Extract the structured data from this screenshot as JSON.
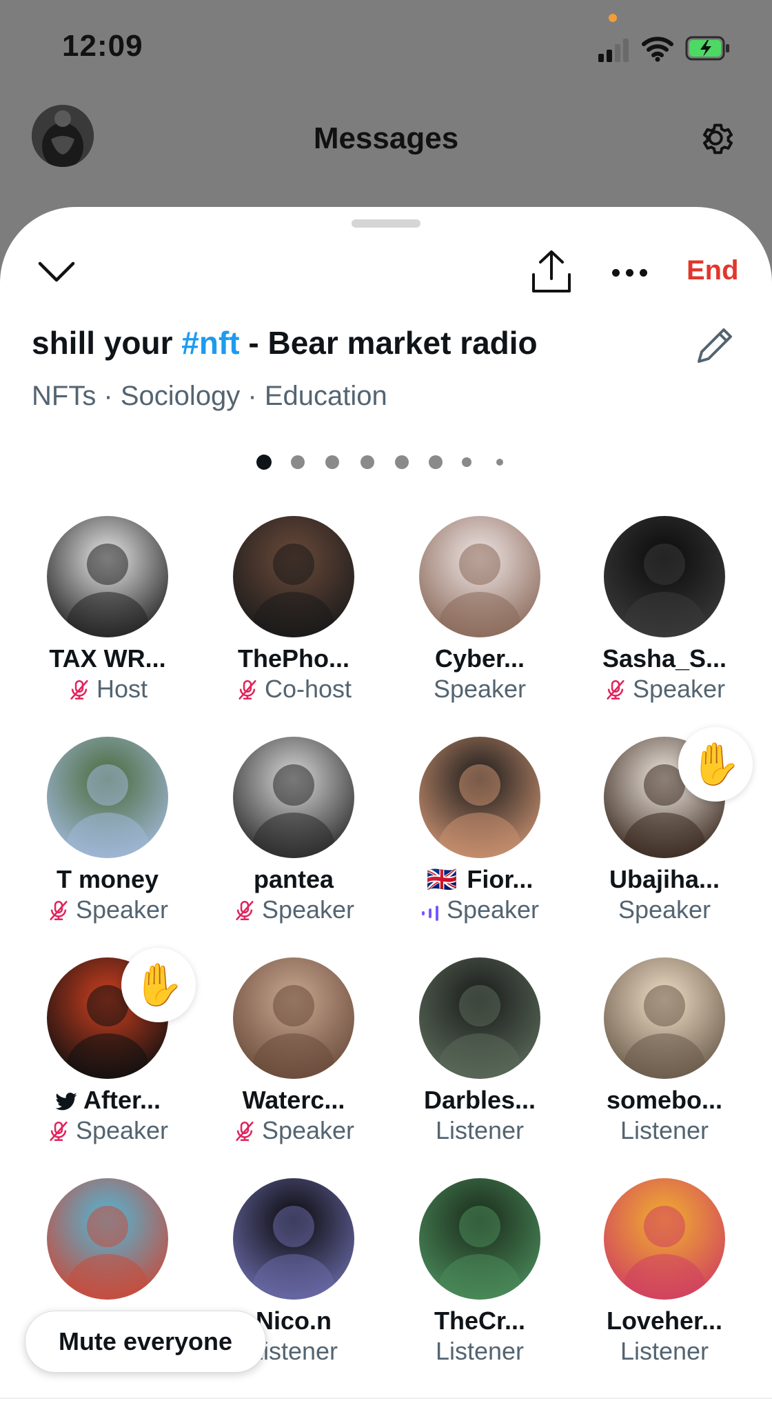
{
  "status_bar": {
    "time": "12:09"
  },
  "header": {
    "title": "Messages",
    "avatar_icon": "profile-avatar",
    "settings_icon": "gear-icon"
  },
  "space": {
    "title_prefix": "shill your ",
    "title_tag": "#nft",
    "title_suffix": " - Bear market radio",
    "topics": "NFTs · Sociology · Education",
    "end_label": "End",
    "page_index": 1,
    "page_count": 8
  },
  "participants": [
    {
      "name": "TAX WR...",
      "role": "Host",
      "muted": true,
      "colors": [
        "#e8e8e8",
        "#222222"
      ]
    },
    {
      "name": "ThePho...",
      "role": "Co-host",
      "muted": true,
      "colors": [
        "#6b4a3a",
        "#1a1a1a"
      ]
    },
    {
      "name": "Cyber...",
      "role": "Speaker",
      "muted": false,
      "colors": [
        "#f0e6e6",
        "#8a6a5a"
      ]
    },
    {
      "name": "Sasha_S...",
      "role": "Speaker",
      "muted": true,
      "colors": [
        "#0a0a0a",
        "#3a3a3a"
      ]
    },
    {
      "name": "T money",
      "role": "Speaker",
      "muted": true,
      "colors": [
        "#4a6a3a",
        "#a0b8d8"
      ]
    },
    {
      "name": "pantea",
      "role": "Speaker",
      "muted": true,
      "colors": [
        "#d8d8d8",
        "#2a2a2a"
      ]
    },
    {
      "name": "Fior...",
      "role": "Speaker",
      "muted": false,
      "speaking": true,
      "flag": "🇬🇧",
      "colors": [
        "#1a1a1a",
        "#c89070"
      ]
    },
    {
      "name": "Ubajiha...",
      "role": "Speaker",
      "muted": false,
      "hand": true,
      "colors": [
        "#f0e8e0",
        "#3a2a20"
      ]
    },
    {
      "name": "After...",
      "role": "Speaker",
      "muted": true,
      "hand": true,
      "bird": true,
      "colors": [
        "#d04020",
        "#101010"
      ]
    },
    {
      "name": "Waterc...",
      "role": "Speaker",
      "muted": true,
      "colors": [
        "#c8a890",
        "#6a4a3a"
      ]
    },
    {
      "name": "Darbles...",
      "role": "Listener",
      "muted": false,
      "colors": [
        "#1a1a1a",
        "#5a6a5a"
      ]
    },
    {
      "name": "somebo...",
      "role": "Listener",
      "muted": false,
      "colors": [
        "#f0e0c8",
        "#6a5a4a"
      ]
    },
    {
      "name": "",
      "role": "",
      "muted": false,
      "colors": [
        "#4fb8d8",
        "#c84a3a"
      ]
    },
    {
      "name": "Nico.n",
      "role": "Listener",
      "muted": false,
      "colors": [
        "#080808",
        "#6a6aa8"
      ]
    },
    {
      "name": "TheCr...",
      "role": "Listener",
      "muted": false,
      "colors": [
        "#1a2a1a",
        "#4a8a5a"
      ]
    },
    {
      "name": "Loveher...",
      "role": "Listener",
      "muted": false,
      "colors": [
        "#f0b030",
        "#d04060"
      ]
    }
  ],
  "mute_everyone": "Mute everyone",
  "colors": {
    "accent_blue": "#1d9bf0",
    "end_red": "#e1372c",
    "mute_pink": "#e0245e",
    "speaking_purple": "#7856ff"
  }
}
